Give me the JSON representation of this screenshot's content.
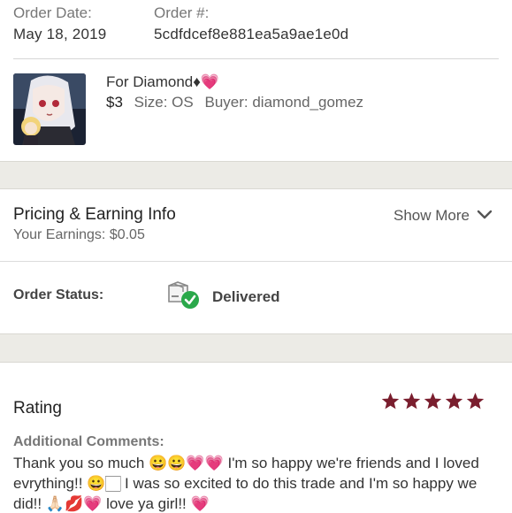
{
  "order": {
    "date_label": "Order Date:",
    "date_value": "May 18, 2019",
    "number_label": "Order #:",
    "number_value": "5cdfdcef8e881ea5a9ae1e0d"
  },
  "item": {
    "title": "For Diamond♦💗",
    "price": "$3",
    "size": "Size: OS",
    "buyer": "Buyer: diamond_gomez"
  },
  "pricing": {
    "title": "Pricing & Earning Info",
    "earnings": "Your Earnings: $0.05",
    "show_more": "Show More"
  },
  "status": {
    "label": "Order Status:",
    "value": "Delivered"
  },
  "rating": {
    "title": "Rating",
    "stars": 5,
    "star_color": "#7a1e2e",
    "comments_label": "Additional Comments:",
    "comments_text": "Thank you so much 😀😀💗💗 I'm so happy we're friends and I loved evrything!! 😀🏻 I was so excited to do this trade and I'm so happy we did!! 🙏🏻💋💗 love ya girl!! 💗"
  },
  "colors": {
    "band": "#ecebe6",
    "check_green": "#2aa84a"
  }
}
